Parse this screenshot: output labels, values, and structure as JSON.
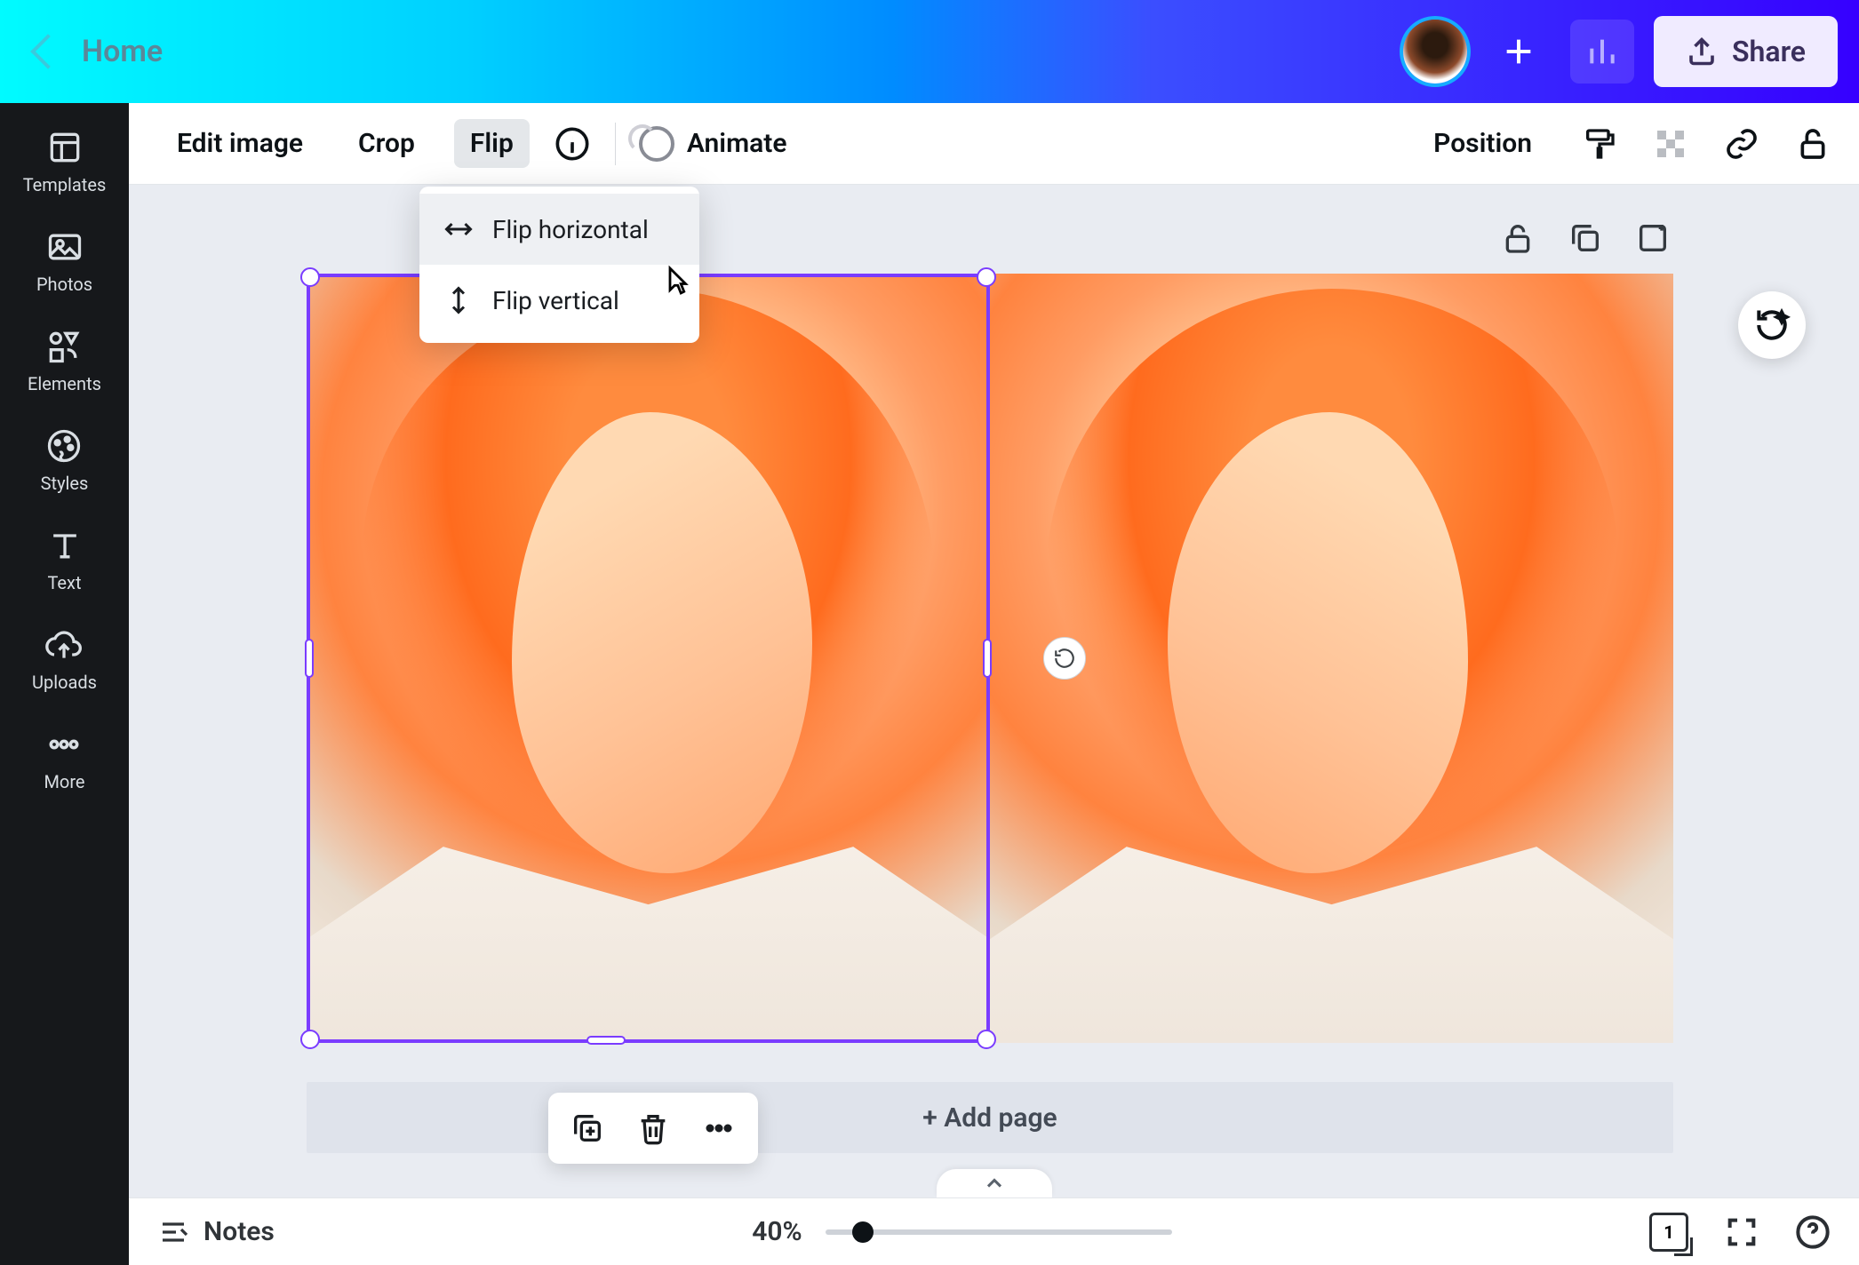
{
  "header": {
    "home_label": "Home",
    "share_label": "Share"
  },
  "sidebar": {
    "items": [
      {
        "label": "Templates",
        "icon": "templates-icon"
      },
      {
        "label": "Photos",
        "icon": "photos-icon"
      },
      {
        "label": "Elements",
        "icon": "elements-icon"
      },
      {
        "label": "Styles",
        "icon": "styles-icon"
      },
      {
        "label": "Text",
        "icon": "text-icon"
      },
      {
        "label": "Uploads",
        "icon": "uploads-icon"
      },
      {
        "label": "More",
        "icon": "more-icon"
      }
    ]
  },
  "context_toolbar": {
    "edit_image_label": "Edit image",
    "crop_label": "Crop",
    "flip_label": "Flip",
    "animate_label": "Animate",
    "position_label": "Position"
  },
  "flip_menu": {
    "horizontal_label": "Flip horizontal",
    "vertical_label": "Flip vertical"
  },
  "canvas": {
    "add_page_label": "+ Add page"
  },
  "bottom_bar": {
    "notes_label": "Notes",
    "zoom_label": "40%",
    "page_indicator": "1"
  },
  "colors": {
    "selection": "#7a3cff"
  }
}
